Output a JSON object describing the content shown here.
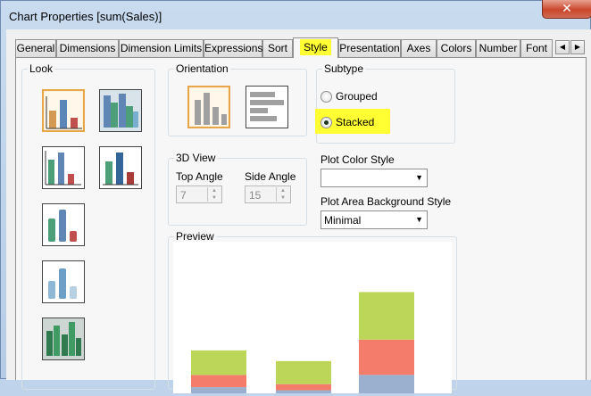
{
  "window": {
    "title": "Chart Properties [sum(Sales)]",
    "close_symbol": "✕"
  },
  "tabs": [
    {
      "label": "General",
      "active": false
    },
    {
      "label": "Dimensions",
      "active": false
    },
    {
      "label": "Dimension Limits",
      "active": false
    },
    {
      "label": "Expressions",
      "active": false
    },
    {
      "label": "Sort",
      "active": false
    },
    {
      "label": "Style",
      "active": true
    },
    {
      "label": "Presentation",
      "active": false
    },
    {
      "label": "Axes",
      "active": false
    },
    {
      "label": "Colors",
      "active": false
    },
    {
      "label": "Number",
      "active": false
    },
    {
      "label": "Font",
      "active": false
    }
  ],
  "tab_scroll": {
    "left": "◀",
    "right": "▶"
  },
  "look": {
    "label": "Look",
    "options": [
      {
        "style": "flat-orange-blue-red",
        "selected": true
      },
      {
        "style": "3d-glossy-blue-green",
        "selected": false
      },
      {
        "style": "flat-blue-green-red",
        "selected": false
      },
      {
        "style": "flat-blue-green-red-alt",
        "selected": false
      },
      {
        "style": "3d-cylinder-green-blue-red",
        "selected": false
      },
      {
        "style": "3d-cylinder-blue-pale",
        "selected": false
      },
      {
        "style": "3d-green-dark",
        "selected": false
      }
    ]
  },
  "orientation": {
    "label": "Orientation",
    "options": [
      {
        "style": "vertical",
        "selected": true
      },
      {
        "style": "horizontal",
        "selected": false
      }
    ]
  },
  "subtype": {
    "label": "Subtype",
    "options": [
      {
        "label": "Grouped",
        "checked": false
      },
      {
        "label": "Stacked",
        "checked": true
      }
    ],
    "highlight_color": "#ffff33"
  },
  "view3d": {
    "label": "3D View",
    "top_angle_label": "Top Angle",
    "top_angle_value": "7",
    "side_angle_label": "Side Angle",
    "side_angle_value": "15"
  },
  "plot_color_style": {
    "label": "Plot Color Style",
    "value": ""
  },
  "plot_area_bg_style": {
    "label": "Plot Area Background Style",
    "value": "Minimal"
  },
  "preview": {
    "label": "Preview",
    "colors": {
      "bottom": "#9bb0cf",
      "middle": "#f47c6a",
      "top": "#bcd659"
    },
    "stacks": [
      {
        "bottom": 0.8,
        "middle": 1.6,
        "top": 3.2
      },
      {
        "bottom": 0.4,
        "middle": 0.8,
        "top": 3.0
      },
      {
        "bottom": 2.4,
        "middle": 4.6,
        "top": 6.2
      }
    ]
  }
}
